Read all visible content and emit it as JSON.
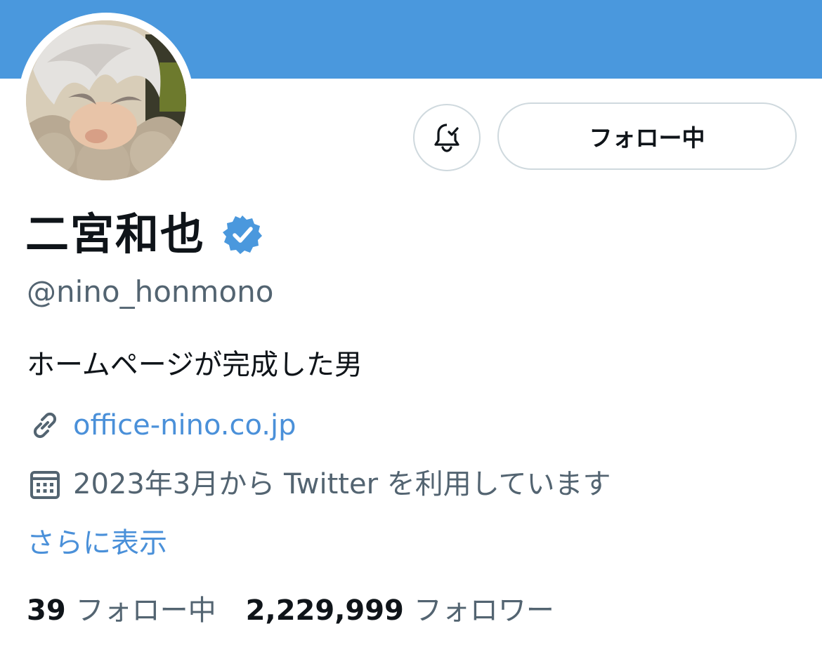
{
  "colors": {
    "banner": "#4a98dd",
    "accent": "#4a90d9",
    "text_primary": "#0f1419",
    "text_secondary": "#536471",
    "verified": "#4a98dd"
  },
  "header": {
    "avatar_icon": "profile-photo",
    "bell_icon": "bell-check-icon",
    "follow_button_label": "フォロー中"
  },
  "profile": {
    "display_name": "二宮和也",
    "verified_icon": "verified-badge-icon",
    "handle": "@nino_honmono",
    "bio": "ホームページが完成した男",
    "website": {
      "icon": "link-icon",
      "text": "office-nino.co.jp"
    },
    "joined": {
      "icon": "calendar-icon",
      "text": "2023年3月から Twitter を利用しています"
    },
    "show_more": "さらに表示"
  },
  "stats": {
    "following_count": "39",
    "following_label": "フォロー中",
    "followers_count": "2,229,999",
    "followers_label": "フォロワー"
  }
}
